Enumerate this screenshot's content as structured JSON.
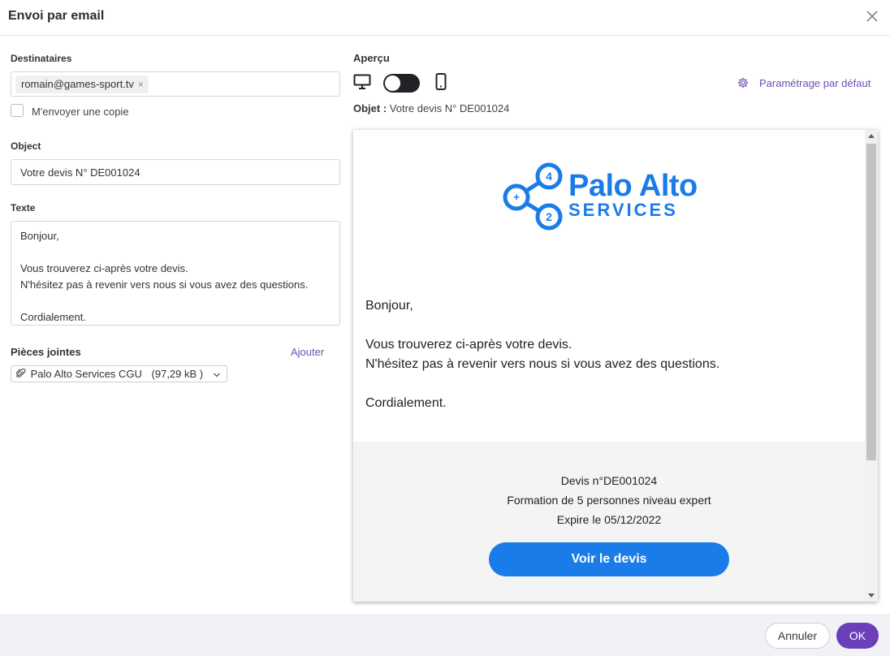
{
  "dialog": {
    "title": "Envoi par email"
  },
  "form": {
    "recipients_label": "Destinataires",
    "recipient_chip": "romain@games-sport.tv",
    "copy_checkbox_label": "M'envoyer une copie",
    "copy_checked": false,
    "object_label": "Object",
    "object_value": "Votre devis N° DE001024",
    "text_label": "Texte",
    "text_lines": [
      "Bonjour,",
      "",
      "Vous trouverez ci-après votre devis.",
      "N'hésitez pas à revenir vers nous si vous avez des questions.",
      "",
      "Cordialement."
    ],
    "attachments_label": "Pièces jointes",
    "add_link": "Ajouter",
    "attachment": "Palo Alto Services CGU",
    "attachment_size": "(97,29 kB )"
  },
  "preview": {
    "label": "Aperçu",
    "default_settings_link": "Paramétrage par défaut",
    "object_prefix": "Objet :",
    "object_value": "Votre devis N° DE001024",
    "logo": {
      "line1": "Palo Alto",
      "line2": "SERVICES",
      "bubble_top": "4",
      "bubble_bottom": "2",
      "bubble_left": "+",
      "color": "#1a7ce8"
    },
    "body_lines": [
      "Bonjour,",
      "",
      "Vous trouverez ci-après votre devis.",
      "N'hésitez pas à revenir vers nous si vous avez des questions.",
      "",
      "Cordialement."
    ],
    "footer": {
      "line1": "Devis n°DE001024",
      "line2": "Formation de 5 personnes niveau expert",
      "line3": "Expire le 05/12/2022",
      "cta": "Voir le devis"
    }
  },
  "actions": {
    "cancel": "Annuler",
    "ok": "OK"
  },
  "colors": {
    "accent": "#6b3fb9",
    "brand_blue": "#1a7ce8"
  }
}
